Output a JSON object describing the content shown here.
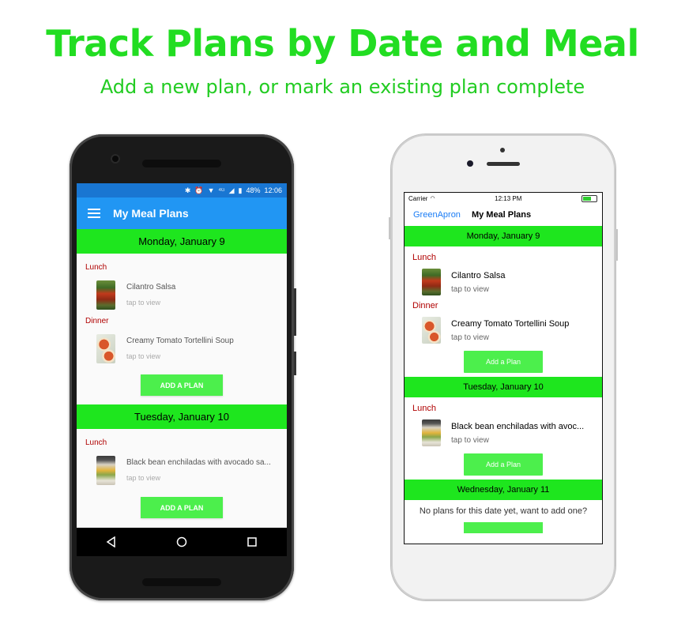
{
  "headline": "Track Plans by Date and Meal",
  "subline": "Add a new plan, or mark an existing plan complete",
  "android": {
    "status": {
      "battery": "48%",
      "time": "12:06",
      "network": "4G"
    },
    "title": "My Meal Plans",
    "days": [
      {
        "date": "Monday, January 9",
        "meals": [
          {
            "meal": "Lunch",
            "recipe": "Cilantro Salsa",
            "sub": "tap to view"
          },
          {
            "meal": "Dinner",
            "recipe": "Creamy Tomato Tortellini Soup",
            "sub": "tap to view"
          }
        ],
        "add_label": "ADD A PLAN"
      },
      {
        "date": "Tuesday, January 10",
        "meals": [
          {
            "meal": "Lunch",
            "recipe": "Black bean enchiladas with avocado sa...",
            "sub": "tap to view"
          }
        ],
        "add_label": "ADD A PLAN"
      }
    ]
  },
  "iphone": {
    "status": {
      "carrier": "Carrier",
      "time": "12:13 PM"
    },
    "back": "GreenApron",
    "title": "My Meal Plans",
    "days": [
      {
        "date": "Monday, January 9",
        "meals": [
          {
            "meal": "Lunch",
            "recipe": "Cilantro Salsa",
            "sub": "tap to view"
          },
          {
            "meal": "Dinner",
            "recipe": "Creamy Tomato Tortellini Soup",
            "sub": "tap to view"
          }
        ],
        "add_label": "Add a Plan"
      },
      {
        "date": "Tuesday, January 10",
        "meals": [
          {
            "meal": "Lunch",
            "recipe": "Black bean enchiladas with avoc...",
            "sub": "tap to view"
          }
        ],
        "add_label": "Add a Plan"
      },
      {
        "date": "Wednesday, January 11",
        "empty_text": "No plans for this date yet, want to add one?"
      }
    ]
  },
  "colors": {
    "headline": "#22dd22",
    "date_bar": "#1ee61e",
    "button": "#4cef4c",
    "appbar": "#2196f3",
    "meal_label": "#b00000"
  }
}
